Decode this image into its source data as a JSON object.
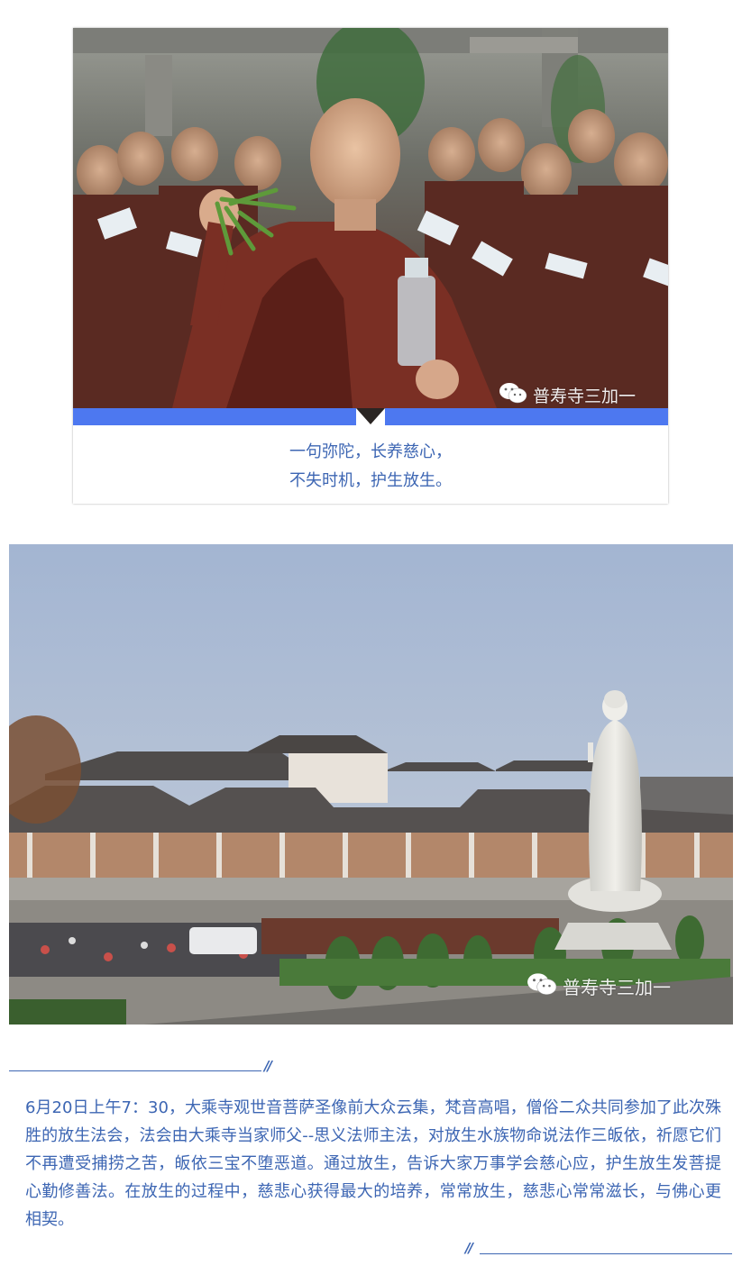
{
  "card": {
    "caption_line1": "一句弥陀，长养慈心，",
    "caption_line2": "不失时机，护生放生。"
  },
  "watermarks": {
    "photo1": "普寿寺三加一",
    "photo2": "普寿寺三加一"
  },
  "divider_top": {
    "mark": "//"
  },
  "article": {
    "paragraph": "6月20日上午7：30，大乘寺观世音菩萨圣像前大众云集，梵音高唱，僧俗二众共同参加了此次殊胜的放生法会，法会由大乘寺当家师父--思义法师主法，对放生水族物命说法作三皈依，祈愿它们不再遭受捕捞之苦，皈依三宝不堕恶道。通过放生，告诉大家万事学会慈心应，护生放生发菩提心勤修善法。在放生的过程中，慈悲心获得最大的培养，常常放生，慈悲心常常滋长，与佛心更相契。"
  },
  "divider_bottom": {
    "mark": "//"
  },
  "colors": {
    "accent_blue": "#3d66b3",
    "bar_blue": "#4d78f0"
  },
  "icons": {
    "watermark_icon": "wechat-icon"
  }
}
